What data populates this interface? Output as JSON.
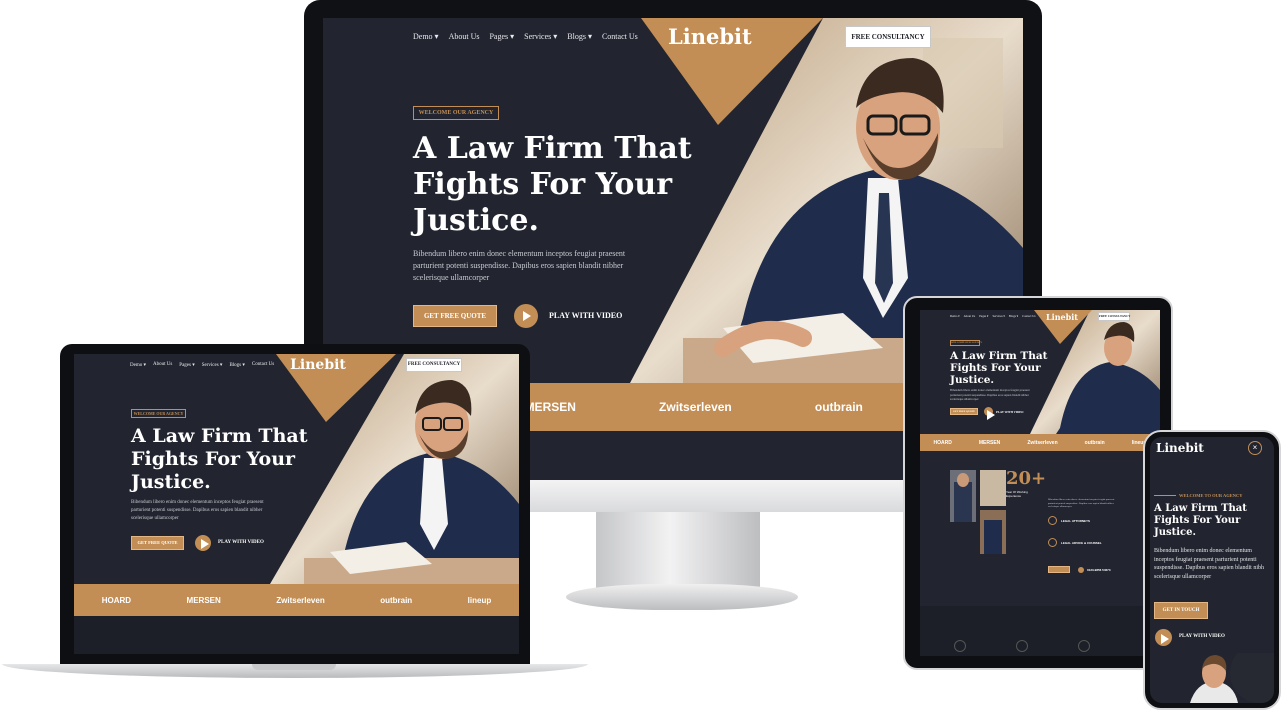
{
  "brand": "Linebit",
  "nav": [
    "Demo ▾",
    "About Us",
    "Pages ▾",
    "Services ▾",
    "Blogs ▾",
    "Contact Us"
  ],
  "cta": "FREE CONSULTANCY",
  "tag": "WELCOME OUR AGENCY",
  "headline": [
    "A Law Firm That",
    "Fights For Your",
    "Justice."
  ],
  "paragraph": "Bibendum libero enim donec elementum inceptos feugiat praesent parturient potenti suspendisse. Dapibus eros sapien blandit nibher scelerisque ullamcorper",
  "primary_button": "GET FREE QUOTE",
  "play_label": "PLAY WITH VIDEO",
  "logos": [
    "HOARD",
    "MERSEN",
    "Zwitserleven",
    "outbrain",
    "lineup"
  ],
  "tablet": {
    "stat_number": "20+",
    "stat_label": "Year Of Working Experience",
    "feature_1": "LEGAL ATTORNEYS",
    "feature_2": "LEGAL ADVICE & COUNSEL",
    "phone_number": "0123-9856 54673"
  },
  "phone": {
    "tag": "WELCOME TO OUR AGENCY",
    "headline": [
      "A Law Firm That",
      "Fights For Your",
      "Justice."
    ],
    "paragraph": "Bibendum libero enim donec elementum inceptos feugiat praesent parturient potenti suspendisse. Dapibus eros sapien blandit nibh scelerisque ullamcorper",
    "button": "GET IN TOUCH",
    "play_label": "PLAY WITH VIDEO"
  },
  "colors": {
    "accent": "#c28e55",
    "dark": "#22252f",
    "navy": "#1f2c4b"
  }
}
